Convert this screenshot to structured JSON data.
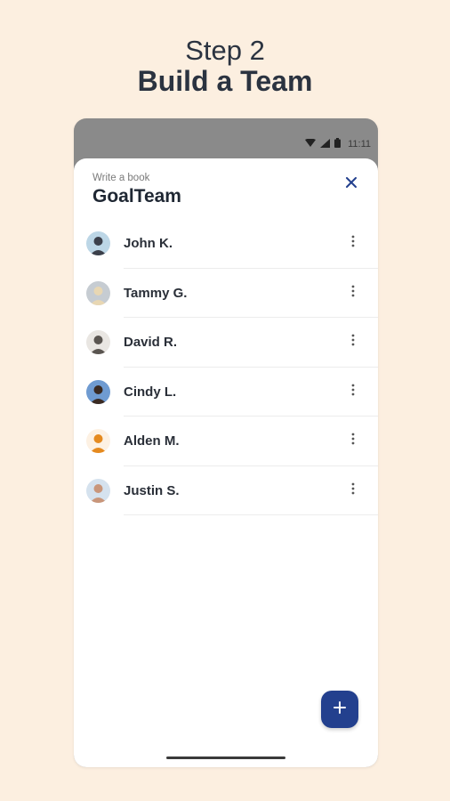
{
  "headline": {
    "step": "Step 2",
    "title": "Build a Team"
  },
  "statusbar": {
    "time": "11:11",
    "icons": [
      "wifi-icon",
      "signal-icon",
      "battery-icon"
    ]
  },
  "sheet": {
    "subtitle": "Write a book",
    "title": "GoalTeam",
    "close_icon": "close-icon"
  },
  "members": [
    {
      "name": "John K.",
      "avatar_bg": "#bcd6e6",
      "avatar_fg": "#3b3f4a"
    },
    {
      "name": "Tammy G.",
      "avatar_bg": "#c6ccd2",
      "avatar_fg": "#e8d7b3"
    },
    {
      "name": "David R.",
      "avatar_bg": "#e9e6e2",
      "avatar_fg": "#5a5550"
    },
    {
      "name": "Cindy L.",
      "avatar_bg": "#6f9bd1",
      "avatar_fg": "#3a2a22"
    },
    {
      "name": "Alden M.",
      "avatar_bg": "#fdf1e3",
      "avatar_fg": "#e58a1f"
    },
    {
      "name": "Justin S.",
      "avatar_bg": "#d5e2ee",
      "avatar_fg": "#c9967a"
    }
  ],
  "fab": {
    "icon": "plus-icon"
  },
  "colors": {
    "background": "#fcefe0",
    "accent": "#23408e",
    "status_bar": "#8a8a8a"
  }
}
